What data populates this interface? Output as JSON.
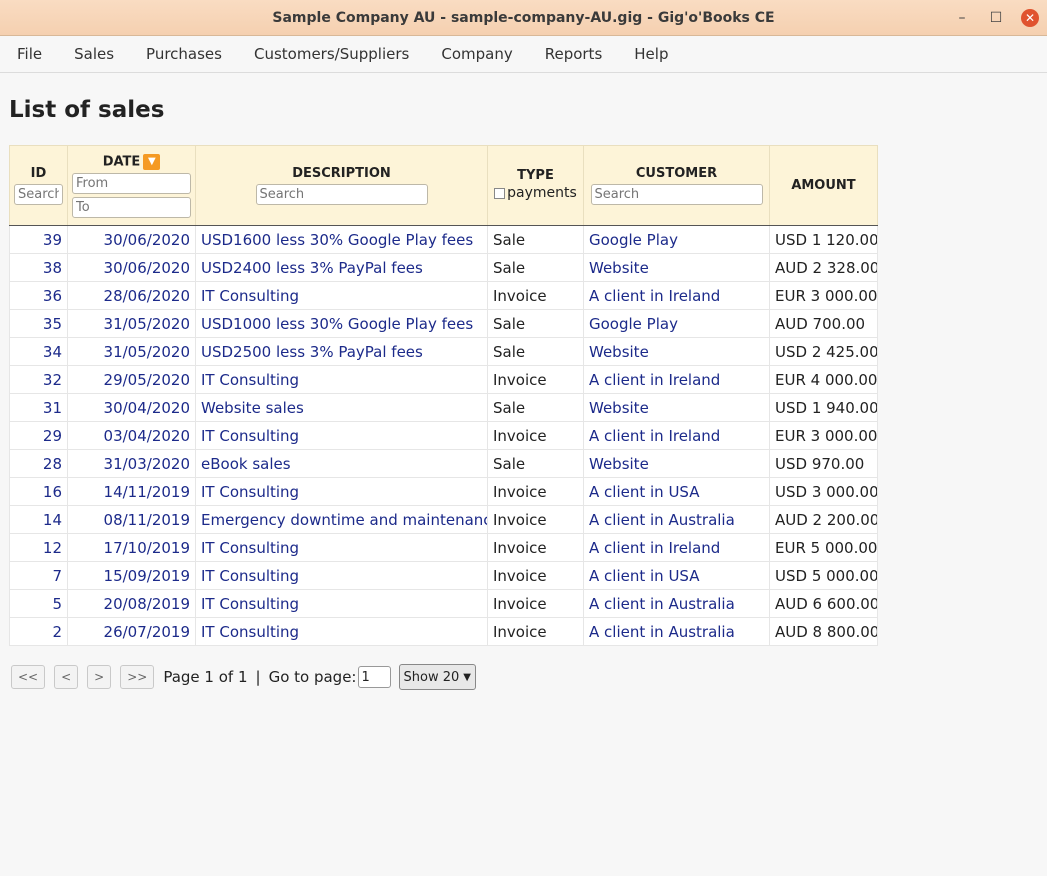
{
  "window": {
    "title": "Sample Company AU - sample-company-AU.gig - Gig'o'Books CE",
    "minimize": "–",
    "maximize": "☐",
    "close": "✕"
  },
  "menu": [
    "File",
    "Sales",
    "Purchases",
    "Customers/Suppliers",
    "Company",
    "Reports",
    "Help"
  ],
  "page": {
    "title": "List of sales"
  },
  "headers": {
    "id": "ID",
    "date": "DATE",
    "description": "DESCRIPTION",
    "type": "TYPE",
    "type_option": "payments",
    "customer": "CUSTOMER",
    "amount": "AMOUNT"
  },
  "filters": {
    "id_placeholder": "Search",
    "date_from_placeholder": "From",
    "date_to_placeholder": "To",
    "description_placeholder": "Search",
    "customer_placeholder": "Search"
  },
  "rows": [
    {
      "id": "39",
      "date": "30/06/2020",
      "description": "USD1600 less 30% Google Play fees",
      "type": "Sale",
      "customer": "Google Play",
      "amount": "USD 1 120.00"
    },
    {
      "id": "38",
      "date": "30/06/2020",
      "description": "USD2400 less 3% PayPal fees",
      "type": "Sale",
      "customer": "Website",
      "amount": "AUD 2 328.00"
    },
    {
      "id": "36",
      "date": "28/06/2020",
      "description": "IT Consulting",
      "type": "Invoice",
      "customer": "A client in Ireland",
      "amount": "EUR 3 000.00"
    },
    {
      "id": "35",
      "date": "31/05/2020",
      "description": "USD1000 less 30% Google Play fees",
      "type": "Sale",
      "customer": "Google Play",
      "amount": "AUD 700.00"
    },
    {
      "id": "34",
      "date": "31/05/2020",
      "description": "USD2500 less 3% PayPal fees",
      "type": "Sale",
      "customer": "Website",
      "amount": "USD 2 425.00"
    },
    {
      "id": "32",
      "date": "29/05/2020",
      "description": "IT Consulting",
      "type": "Invoice",
      "customer": "A client in Ireland",
      "amount": "EUR 4 000.00"
    },
    {
      "id": "31",
      "date": "30/04/2020",
      "description": "Website sales",
      "type": "Sale",
      "customer": "Website",
      "amount": "USD 1 940.00"
    },
    {
      "id": "29",
      "date": "03/04/2020",
      "description": "IT Consulting",
      "type": "Invoice",
      "customer": "A client in Ireland",
      "amount": "EUR 3 000.00"
    },
    {
      "id": "28",
      "date": "31/03/2020",
      "description": "eBook sales",
      "type": "Sale",
      "customer": "Website",
      "amount": "USD 970.00"
    },
    {
      "id": "16",
      "date": "14/11/2019",
      "description": "IT Consulting",
      "type": "Invoice",
      "customer": "A client in USA",
      "amount": "USD 3 000.00"
    },
    {
      "id": "14",
      "date": "08/11/2019",
      "description": "Emergency downtime and maintenance",
      "type": "Invoice",
      "customer": "A client in Australia",
      "amount": "AUD 2 200.00"
    },
    {
      "id": "12",
      "date": "17/10/2019",
      "description": "IT Consulting",
      "type": "Invoice",
      "customer": "A client in Ireland",
      "amount": "EUR 5 000.00"
    },
    {
      "id": "7",
      "date": "15/09/2019",
      "description": "IT Consulting",
      "type": "Invoice",
      "customer": "A client in USA",
      "amount": "USD 5 000.00"
    },
    {
      "id": "5",
      "date": "20/08/2019",
      "description": "IT Consulting",
      "type": "Invoice",
      "customer": "A client in Australia",
      "amount": "AUD 6 600.00"
    },
    {
      "id": "2",
      "date": "26/07/2019",
      "description": "IT Consulting",
      "type": "Invoice",
      "customer": "A client in Australia",
      "amount": "AUD 8 800.00"
    }
  ],
  "pager": {
    "first": "<<",
    "prev": "<",
    "next": ">",
    "last": ">>",
    "page_info": "Page 1 of 1",
    "separator": "|",
    "goto_label": "Go to page:",
    "goto_value": "1",
    "show": "Show 20"
  },
  "colors": {
    "titlebar": "#f5d0b0",
    "header_bg": "#fdf4d8",
    "link": "#1c2a8a",
    "sort_icon": "#f59a23",
    "close": "#e0532f"
  },
  "icons": {
    "sort": "sort-descending-icon",
    "close": "close-icon",
    "dropdown": "chevron-down-icon"
  }
}
